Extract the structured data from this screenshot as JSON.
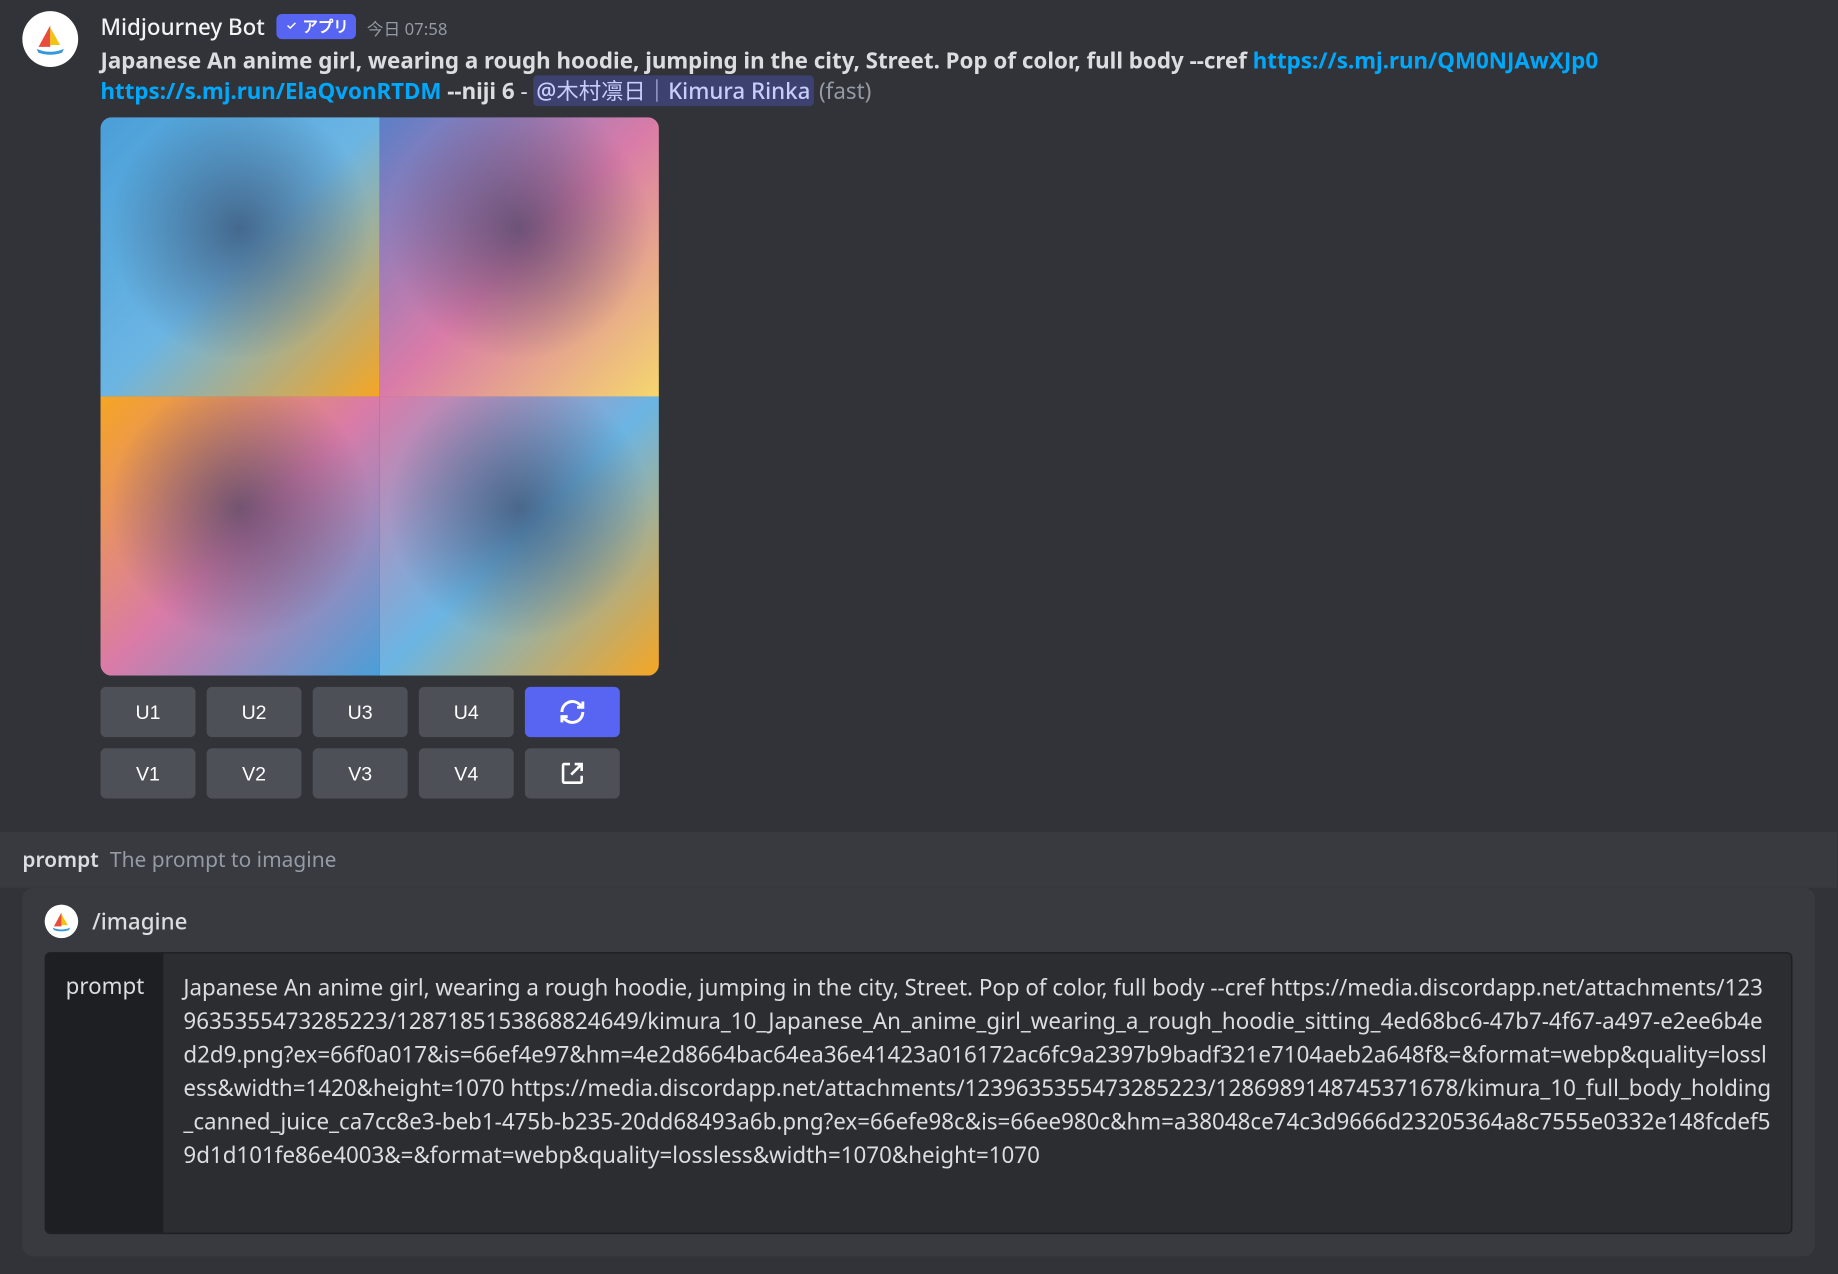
{
  "message": {
    "username": "Midjourney Bot",
    "bot_tag": "アプリ",
    "timestamp": "今日 07:58",
    "prompt_text": "Japanese An anime girl, wearing a rough hoodie, jumping in the city, Street. Pop of color, full body",
    "cref_flag": " --cref ",
    "link1": "https://s.mj.run/QM0NJAwXJp0",
    "link2": "https://s.mj.run/ElaQvonRTDM",
    "niji_flag": " --niji 6",
    "dash": " - ",
    "mention": "@木村凛日｜Kimura Rinka",
    "fast": " (fast)"
  },
  "buttons": {
    "row1": [
      "U1",
      "U2",
      "U3",
      "U4"
    ],
    "row2": [
      "V1",
      "V2",
      "V3",
      "V4"
    ]
  },
  "prompt_hint": {
    "name": "prompt",
    "desc": "The prompt to imagine"
  },
  "command": {
    "slash": "/imagine",
    "field_label": "prompt",
    "value": "Japanese An anime girl, wearing a rough hoodie, jumping in the city, Street. Pop of color, full body --cref https://media.discordapp.net/attachments/1239635355473285223/1287185153868824649/kimura_10_Japanese_An_anime_girl_wearing_a_rough_hoodie_sitting_4ed68bc6-47b7-4f67-a497-e2ee6b4ed2d9.png?ex=66f0a017&is=66ef4e97&hm=4e2d8664bac64ea36e41423a016172ac6fc9a2397b9badf321e7104aeb2a648f&=&format=webp&quality=lossless&width=1420&height=1070 https://media.discordapp.net/attachments/1239635355473285223/1286989148745371678/kimura_10_full_body_holding_canned_juice_ca7cc8e3-beb1-475b-b235-20dd68493a6b.png?ex=66efe98c&is=66ee980c&hm=a38048ce74c3d9666d23205364a8c7555e0332e148fcdef59d1d101fe86e4003&=&format=webp&quality=lossless&width=1070&height=1070"
  }
}
